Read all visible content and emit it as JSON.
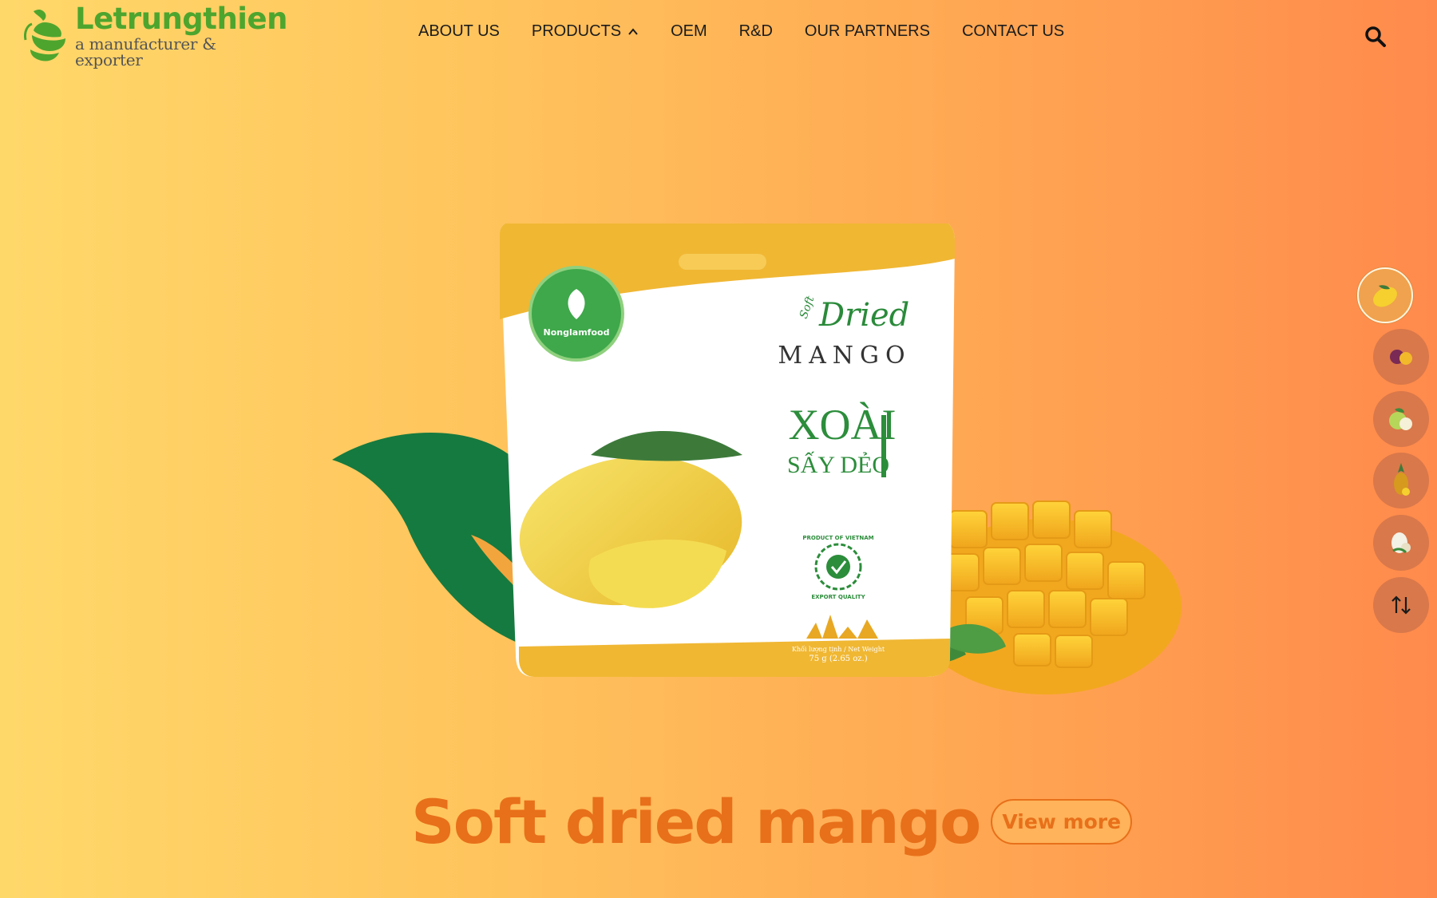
{
  "brand": {
    "name": "Letrungthien",
    "tagline": "a manufacturer & exporter"
  },
  "nav": {
    "items": [
      {
        "label": "ABOUT US"
      },
      {
        "label": "PRODUCTS"
      },
      {
        "label": "OEM"
      },
      {
        "label": "R&D"
      },
      {
        "label": "OUR PARTNERS"
      },
      {
        "label": "CONTACT US"
      }
    ]
  },
  "hero": {
    "package": {
      "brand": "Nonglamfood",
      "script": "Dried",
      "soft": "Soft",
      "product": "MANGO",
      "vn_line1": "XOÀI",
      "vn_line2": "SẤY DẺO",
      "badge_top": "PRODUCT OF VIETNAM",
      "badge_bottom": "EXPORT QUALITY",
      "weight_label": "Khối lượng tịnh / Net Weight",
      "weight": "75 g (2.65 oz.)"
    },
    "title": "Soft dried mango",
    "cta": "View more"
  },
  "rail": {
    "items": [
      "mango",
      "passion-fruit",
      "guava",
      "pineapple",
      "coconut"
    ],
    "active": 0
  },
  "icons": {
    "search": "search-icon",
    "sort": "swap-vertical-icon"
  },
  "colors": {
    "brand_green": "#4da52e",
    "accent_orange": "#e8701a",
    "leaf_green": "#157a3f"
  }
}
